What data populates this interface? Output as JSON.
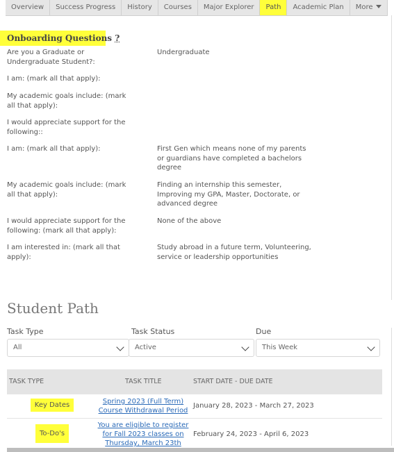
{
  "tabs": [
    {
      "label": "Overview",
      "active": false
    },
    {
      "label": "Success Progress",
      "active": false
    },
    {
      "label": "History",
      "active": false
    },
    {
      "label": "Courses",
      "active": false
    },
    {
      "label": "Major Explorer",
      "active": false
    },
    {
      "label": "Path",
      "active": true
    },
    {
      "label": "Academic Plan",
      "active": false
    },
    {
      "label": "More",
      "active": false,
      "icon": "caret-down-icon"
    }
  ],
  "onboarding": {
    "title": "Onboarding Questions",
    "help_mark": "?",
    "items": [
      {
        "question": "Are you a Graduate or Undergraduate Student?:",
        "answer": "Undergraduate"
      },
      {
        "question": "I am: (mark all that apply):",
        "answer": ""
      },
      {
        "question": "My academic goals include: (mark all that apply):",
        "answer": ""
      },
      {
        "question": "I would appreciate support for the following::",
        "answer": ""
      },
      {
        "question": "I am: (mark all that apply):",
        "answer": "First Gen which means none of my parents or guardians have completed a bachelors degree"
      },
      {
        "question": "My academic goals include: (mark all that apply):",
        "answer": "Finding an internship this semester, Improving my GPA, Master, Doctorate, or advanced degree"
      },
      {
        "question": "I would appreciate support for the following: (mark all that apply):",
        "answer": "None of the above"
      },
      {
        "question": "I am interested in: (mark all that apply):",
        "answer": "Study abroad in a future term, Volunteering, service or leadership opportunities"
      }
    ]
  },
  "student_path": {
    "title": "Student Path",
    "filters": [
      {
        "label": "Task Type",
        "value": "All"
      },
      {
        "label": "Task Status",
        "value": "Active"
      },
      {
        "label": "Due",
        "value": "This Week"
      }
    ],
    "table": {
      "headers": [
        "TASK TYPE",
        "TASK TITLE",
        "START DATE - DUE DATE"
      ],
      "rows": [
        {
          "type": "Key Dates",
          "title": "Spring 2023 (Full Term) Course Withdrawal Period",
          "dates": "January 28, 2023 - March 27, 2023"
        },
        {
          "type": "To-Do's",
          "title": "You are eligible to register for Fall 2023 classes on Thursday, March 23th",
          "dates": "February 24, 2023 - April 6, 2023"
        }
      ]
    }
  },
  "colors": {
    "highlight": "#ffff3a",
    "link": "#2a6ab8",
    "tab_bg": "#e6e6e6",
    "table_header_bg": "#e4e4e4"
  }
}
